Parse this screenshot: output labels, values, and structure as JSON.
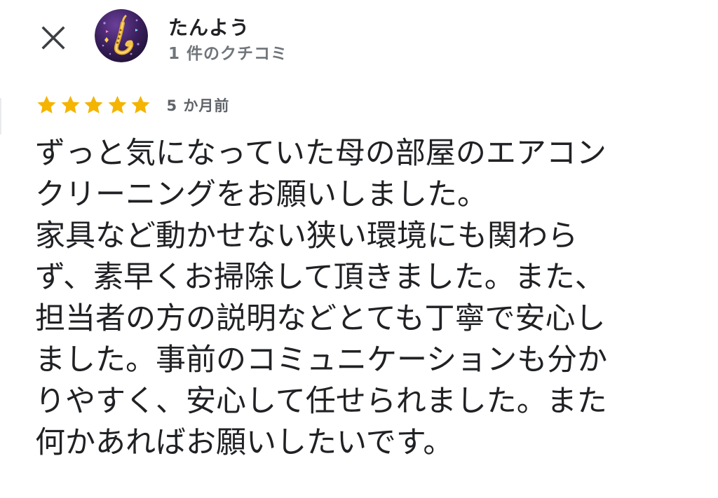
{
  "header": {
    "close_icon": "close-icon",
    "reviewer": {
      "name": "たんよう",
      "review_count": "1 件のクチコミ",
      "avatar_icon": "saxophone-avatar"
    }
  },
  "review": {
    "rating": 5,
    "max_rating": 5,
    "star_color": "#f4b400",
    "date": "5 か月前",
    "lines": [
      "ずっと気になっていた母の部屋のエアコン",
      "クリーニングをお願いしました。",
      "家具など動かせない狭い環境にも関わら",
      "ず、素早くお掃除して頂きました。また、",
      "担当者の方の説明などとても丁寧で安心し",
      "ました。事前のコミュニケーションも分か",
      "りやすく、安心して任せられました。また",
      "何かあればお願いしたいです。"
    ]
  }
}
